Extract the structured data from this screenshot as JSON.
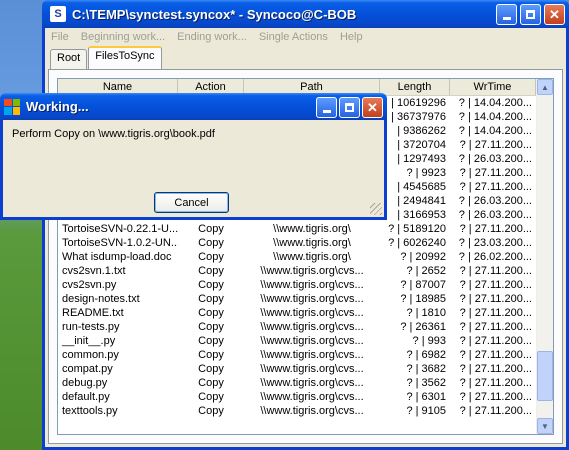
{
  "main_window": {
    "title": "C:\\TEMP\\synctest.syncox* - Syncoco@C-BOB",
    "icon_letter": "S"
  },
  "menu": [
    "File",
    "Beginning work...",
    "Ending work...",
    "Single Actions",
    "Help"
  ],
  "tabs": [
    {
      "label": "Root",
      "active": false
    },
    {
      "label": "FilesToSync",
      "active": true
    }
  ],
  "columns": [
    "Name",
    "Action",
    "Path",
    "Length",
    "WrTime"
  ],
  "rows": [
    {
      "name": "",
      "action": "",
      "path": "",
      "length": "| 10619296",
      "wrtime": "? | 14.04.200..."
    },
    {
      "name": "",
      "action": "",
      "path": "",
      "length": "| 36737976",
      "wrtime": "? | 14.04.200..."
    },
    {
      "name": "",
      "action": "",
      "path": "",
      "length": "| 9386262",
      "wrtime": "? | 14.04.200..."
    },
    {
      "name": "",
      "action": "",
      "path": "",
      "length": "| 3720704",
      "wrtime": "? | 27.11.200..."
    },
    {
      "name": "",
      "action": "",
      "path": "",
      "length": "| 1297493",
      "wrtime": "? | 26.03.200..."
    },
    {
      "name": "",
      "action": "",
      "path": "",
      "length": "? | 9923",
      "wrtime": "? | 27.11.200..."
    },
    {
      "name": "",
      "action": "",
      "path": "",
      "length": "| 4545685",
      "wrtime": "? | 27.11.200..."
    },
    {
      "name": "",
      "action": "",
      "path": "",
      "length": "| 2494841",
      "wrtime": "? | 26.03.200..."
    },
    {
      "name": "",
      "action": "",
      "path": "",
      "length": "| 3166953",
      "wrtime": "? | 26.03.200..."
    },
    {
      "name": "TortoiseSVN-0.22.1-U...",
      "action": "Copy",
      "path": "\\\\www.tigris.org\\",
      "length": "? | 5189120",
      "wrtime": "? | 27.11.200..."
    },
    {
      "name": "TortoiseSVN-1.0.2-UN...",
      "action": "Copy",
      "path": "\\\\www.tigris.org\\",
      "length": "? | 6026240",
      "wrtime": "? | 23.03.200..."
    },
    {
      "name": "What isdump-load.doc",
      "action": "Copy",
      "path": "\\\\www.tigris.org\\",
      "length": "? | 20992",
      "wrtime": "? | 26.02.200..."
    },
    {
      "name": "cvs2svn.1.txt",
      "action": "Copy",
      "path": "\\\\www.tigris.org\\cvs...",
      "length": "? | 2652",
      "wrtime": "? | 27.11.200..."
    },
    {
      "name": "cvs2svn.py",
      "action": "Copy",
      "path": "\\\\www.tigris.org\\cvs...",
      "length": "? | 87007",
      "wrtime": "? | 27.11.200..."
    },
    {
      "name": "design-notes.txt",
      "action": "Copy",
      "path": "\\\\www.tigris.org\\cvs...",
      "length": "? | 18985",
      "wrtime": "? | 27.11.200..."
    },
    {
      "name": "README.txt",
      "action": "Copy",
      "path": "\\\\www.tigris.org\\cvs...",
      "length": "? | 1810",
      "wrtime": "? | 27.11.200..."
    },
    {
      "name": "run-tests.py",
      "action": "Copy",
      "path": "\\\\www.tigris.org\\cvs...",
      "length": "? | 26361",
      "wrtime": "? | 27.11.200..."
    },
    {
      "name": "__init__.py",
      "action": "Copy",
      "path": "\\\\www.tigris.org\\cvs...",
      "length": "? | 993",
      "wrtime": "? | 27.11.200..."
    },
    {
      "name": "common.py",
      "action": "Copy",
      "path": "\\\\www.tigris.org\\cvs...",
      "length": "? | 6982",
      "wrtime": "? | 27.11.200..."
    },
    {
      "name": "compat.py",
      "action": "Copy",
      "path": "\\\\www.tigris.org\\cvs...",
      "length": "? | 3682",
      "wrtime": "? | 27.11.200..."
    },
    {
      "name": "debug.py",
      "action": "Copy",
      "path": "\\\\www.tigris.org\\cvs...",
      "length": "? | 3562",
      "wrtime": "? | 27.11.200..."
    },
    {
      "name": "default.py",
      "action": "Copy",
      "path": "\\\\www.tigris.org\\cvs...",
      "length": "? | 6301",
      "wrtime": "? | 27.11.200..."
    },
    {
      "name": "texttools.py",
      "action": "Copy",
      "path": "\\\\www.tigris.org\\cvs...",
      "length": "? | 9105",
      "wrtime": "? | 27.11.200..."
    }
  ],
  "dialog": {
    "title": "Working...",
    "message": "Perform Copy on \\www.tigris.org\\book.pdf",
    "cancel_label": "Cancel"
  },
  "colors": {
    "titlebar": "#0451da",
    "face": "#ece9d8",
    "accent": "#ffc83c"
  }
}
